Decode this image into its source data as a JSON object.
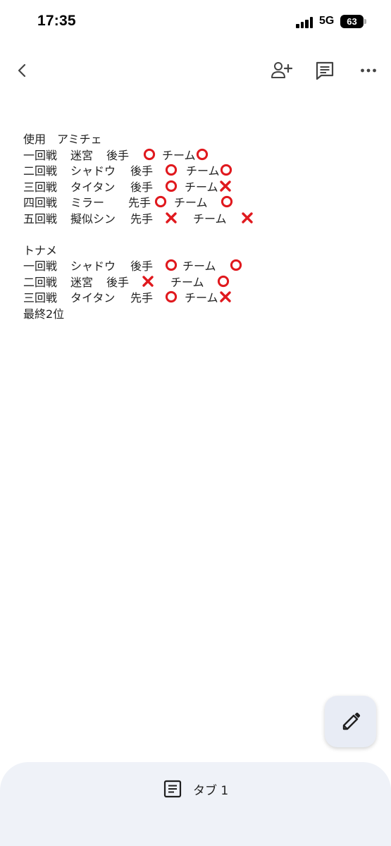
{
  "status_bar": {
    "time": "17:35",
    "network": "5G",
    "battery_level": "63",
    "icons": [
      "signal-icon",
      "battery-icon"
    ]
  },
  "toolbar": {
    "icons": [
      "back-arrow-icon",
      "add-person-icon",
      "comment-icon",
      "more-icon"
    ]
  },
  "document": {
    "header": "使用　アミチェ",
    "section1_rows": [
      {
        "round": "一回戦",
        "opponent": "迷宮",
        "turn": "後手",
        "result": "○",
        "team_label": "チーム",
        "team_result": "○"
      },
      {
        "round": "二回戦",
        "opponent": "シャドウ",
        "turn": "後手",
        "result": "○",
        "team_label": "チーム",
        "team_result": "○"
      },
      {
        "round": "三回戦",
        "opponent": "タイタン",
        "turn": "後手",
        "result": "○",
        "team_label": "チーム",
        "team_result": "×"
      },
      {
        "round": "四回戦",
        "opponent": "ミラー",
        "turn": "先手",
        "result": "○",
        "team_label": "チーム",
        "team_result": "○"
      },
      {
        "round": "五回戦",
        "opponent": "擬似シン",
        "turn": "先手",
        "result": "×",
        "team_label": "チーム",
        "team_result": "×"
      }
    ],
    "section2_title": "トナメ",
    "section2_rows": [
      {
        "round": "一回戦",
        "opponent": "シャドウ",
        "turn": "後手",
        "result": "○",
        "team_label": "チーム",
        "team_result": "○"
      },
      {
        "round": "二回戦",
        "opponent": "迷宮",
        "turn": "後手",
        "result": "×",
        "team_label": "チーム",
        "team_result": "○"
      },
      {
        "round": "三回戦",
        "opponent": "タイタン",
        "turn": "先手",
        "result": "○",
        "team_label": "チーム",
        "team_result": "×"
      }
    ],
    "final": "最終2位",
    "mark_color": "#e0191e"
  },
  "fab": {
    "icon": "pencil-icon"
  },
  "bottom_tab": {
    "label": "タブ 1",
    "icon": "document-icon"
  }
}
